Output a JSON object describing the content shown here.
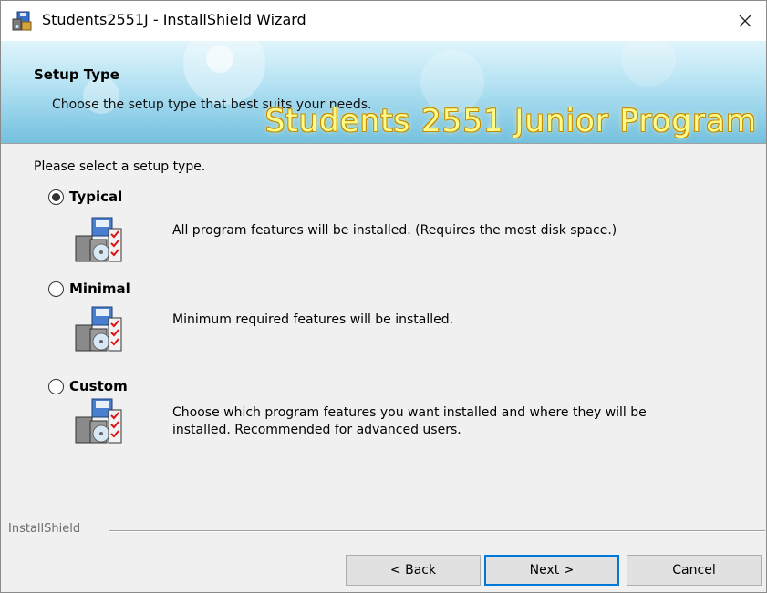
{
  "window": {
    "title": "Students2551J - InstallShield Wizard",
    "close_glyph": "✕"
  },
  "banner": {
    "heading": "Setup Type",
    "subheading": "Choose the setup type that best suits your needs.",
    "brand_text": "Students 2551 Junior Program"
  },
  "content": {
    "prompt": "Please select a setup type.",
    "options": [
      {
        "label": "Typical",
        "selected": true,
        "description": "All program features will be installed. (Requires the most disk space.)",
        "icon": "setup-package-icon"
      },
      {
        "label": "Minimal",
        "selected": false,
        "description": "Minimum required features will be installed.",
        "icon": "setup-package-icon"
      },
      {
        "label": "Custom",
        "selected": false,
        "description": "Choose which program features you want installed and where they will be installed. Recommended for advanced users.",
        "icon": "setup-package-icon"
      }
    ]
  },
  "footer": {
    "brand": "InstallShield",
    "back_label": "< Back",
    "next_label": "Next >",
    "cancel_label": "Cancel"
  },
  "colors": {
    "default_button_border": "#0078d7",
    "banner_top": "#dff4fb",
    "banner_bottom": "#74c0de",
    "brand_text": "#fffb8a"
  }
}
